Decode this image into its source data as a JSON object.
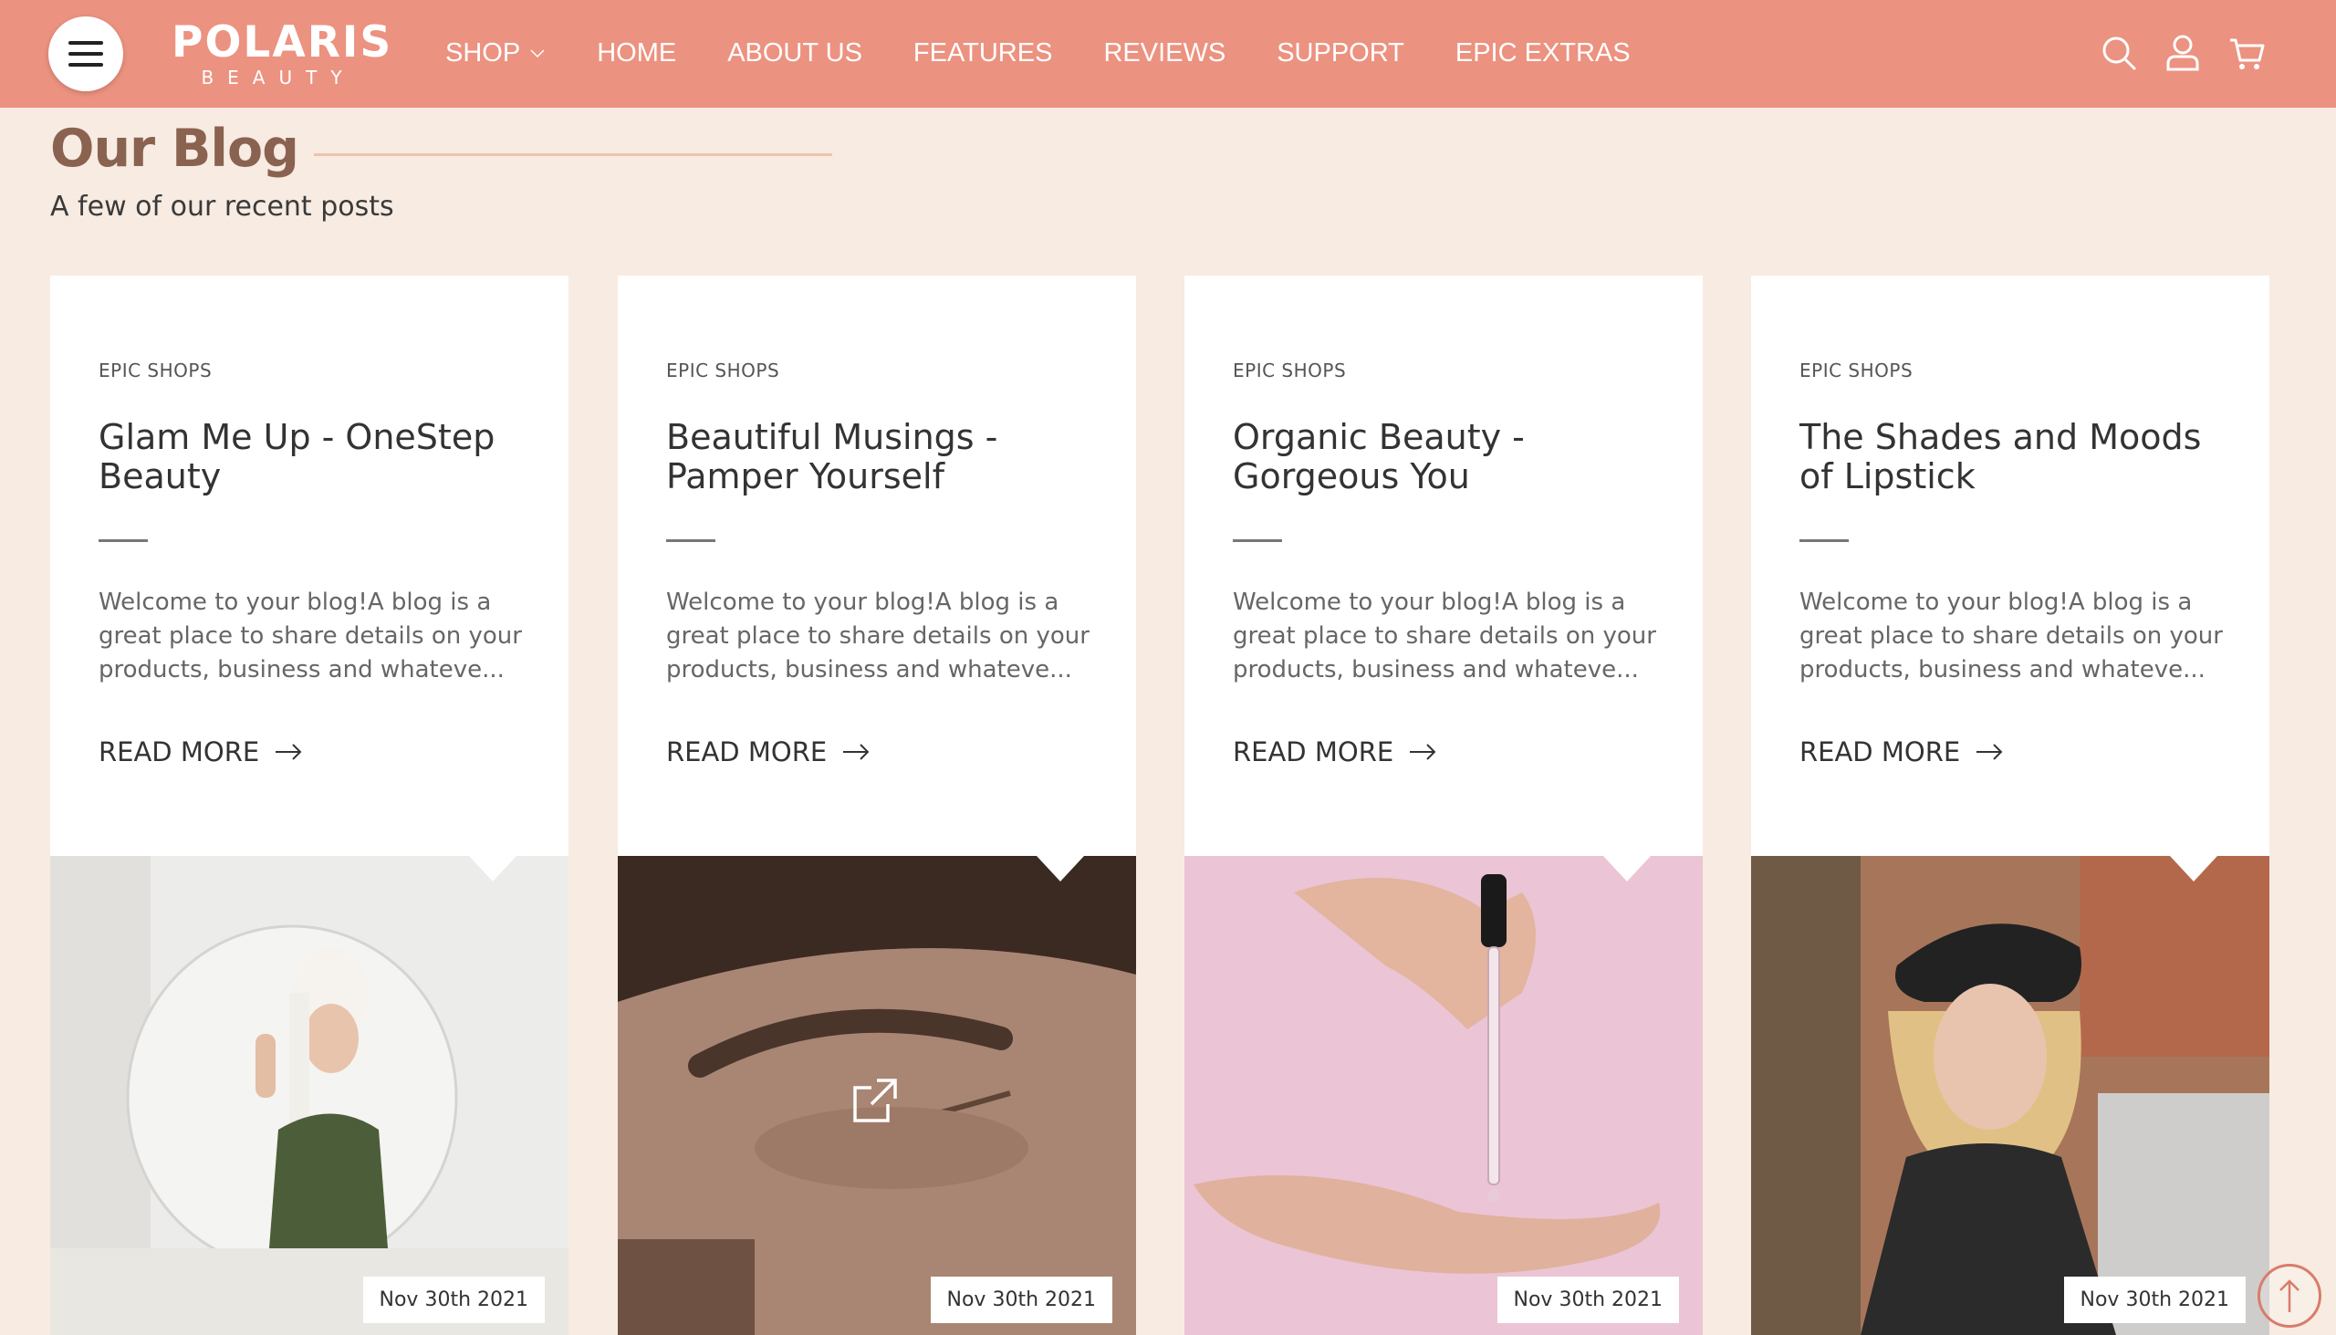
{
  "header": {
    "brand": "POLARIS",
    "brand_sub": "BEAUTY",
    "nav": [
      "SHOP",
      "HOME",
      "ABOUT US",
      "FEATURES",
      "REVIEWS",
      "SUPPORT",
      "EPIC EXTRAS"
    ],
    "icons": [
      "search-icon",
      "user-icon",
      "cart-icon"
    ]
  },
  "blog": {
    "title": "Our Blog",
    "subtitle": "A few of our recent posts",
    "posts": [
      {
        "category": "EPIC SHOPS",
        "title": "Glam Me Up - OneStep Beauty",
        "excerpt": "Welcome to your blog!A blog is a great place to share details on your products, business and whateve...",
        "read_more": "READ MORE",
        "date": "Nov 30th 2021"
      },
      {
        "category": "EPIC SHOPS",
        "title": "Beautiful Musings - Pamper Yourself",
        "excerpt": "Welcome to your blog!A blog is a great place to share details on your products, business and whateve...",
        "read_more": "READ MORE",
        "date": "Nov 30th 2021"
      },
      {
        "category": "EPIC SHOPS",
        "title": "Organic Beauty - Gorgeous You",
        "excerpt": "Welcome to your blog!A blog is a great place to share details on your products, business and whateve...",
        "read_more": "READ MORE",
        "date": "Nov 30th 2021"
      },
      {
        "category": "EPIC SHOPS",
        "title": "The Shades and Moods of Lipstick",
        "excerpt": "Welcome to your blog!A blog is a great place to share details on your products, business and whateve...",
        "read_more": "READ MORE",
        "date": "Nov 30th 2021"
      }
    ]
  },
  "colors": {
    "header_bg": "#ec9280",
    "page_bg": "#f7ebe2",
    "title_color": "#8a6250",
    "accent_line": "#eec3a9"
  }
}
